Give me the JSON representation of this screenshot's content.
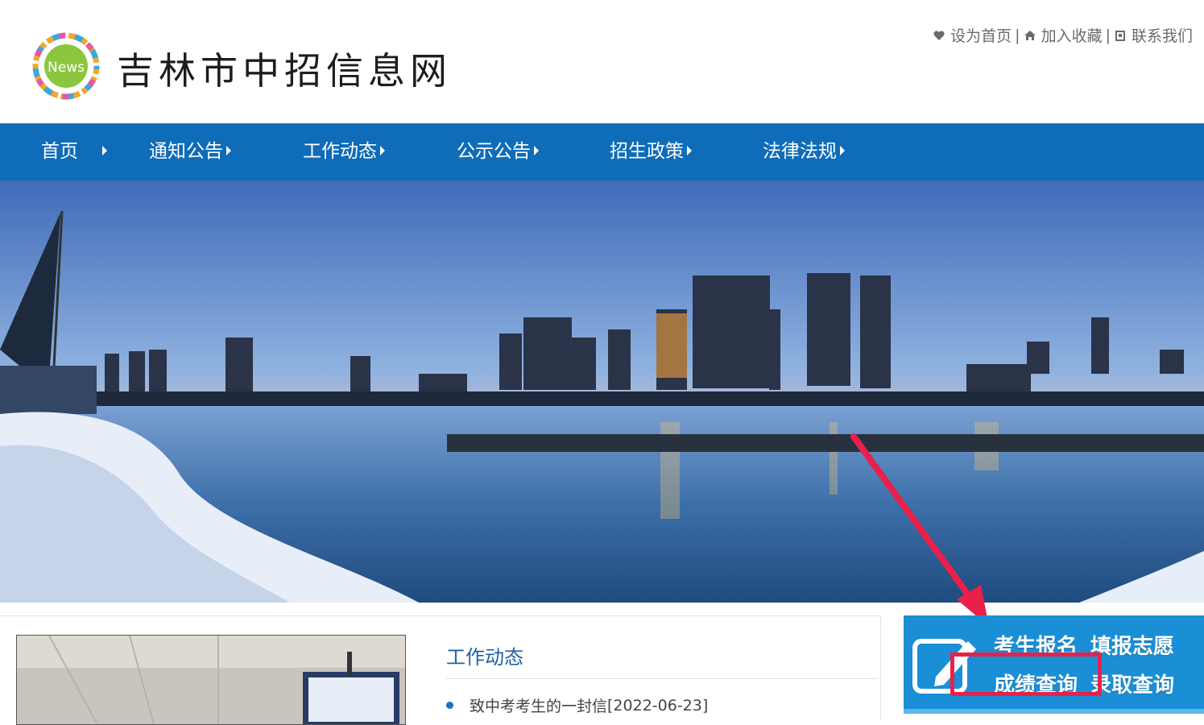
{
  "header": {
    "site_title": "吉林市中招信息网",
    "logo_text": "News",
    "top_links": [
      {
        "label": "设为首页",
        "icon": "heart-icon"
      },
      {
        "label": "加入收藏",
        "icon": "home-icon"
      },
      {
        "label": "联系我们",
        "icon": "contact-icon"
      }
    ]
  },
  "nav": {
    "items": [
      {
        "label": "首页"
      },
      {
        "label": "通知公告"
      },
      {
        "label": "工作动态"
      },
      {
        "label": "公示公告"
      },
      {
        "label": "招生政策"
      },
      {
        "label": "法律法规"
      }
    ]
  },
  "main": {
    "section_title": "工作动态",
    "news": [
      {
        "title": "致中考考生的一封信",
        "date": "[2022-06-23]"
      }
    ]
  },
  "side_panel": {
    "links": [
      {
        "label": "考生报名"
      },
      {
        "label": "填报志愿"
      },
      {
        "label": "成绩查询"
      },
      {
        "label": "录取查询"
      }
    ]
  },
  "colors": {
    "nav_bg": "#0f6cb8",
    "side_panel_bg": "#1a8fd6",
    "annotation_red": "#e8204a",
    "section_title": "#1f5fa3"
  }
}
